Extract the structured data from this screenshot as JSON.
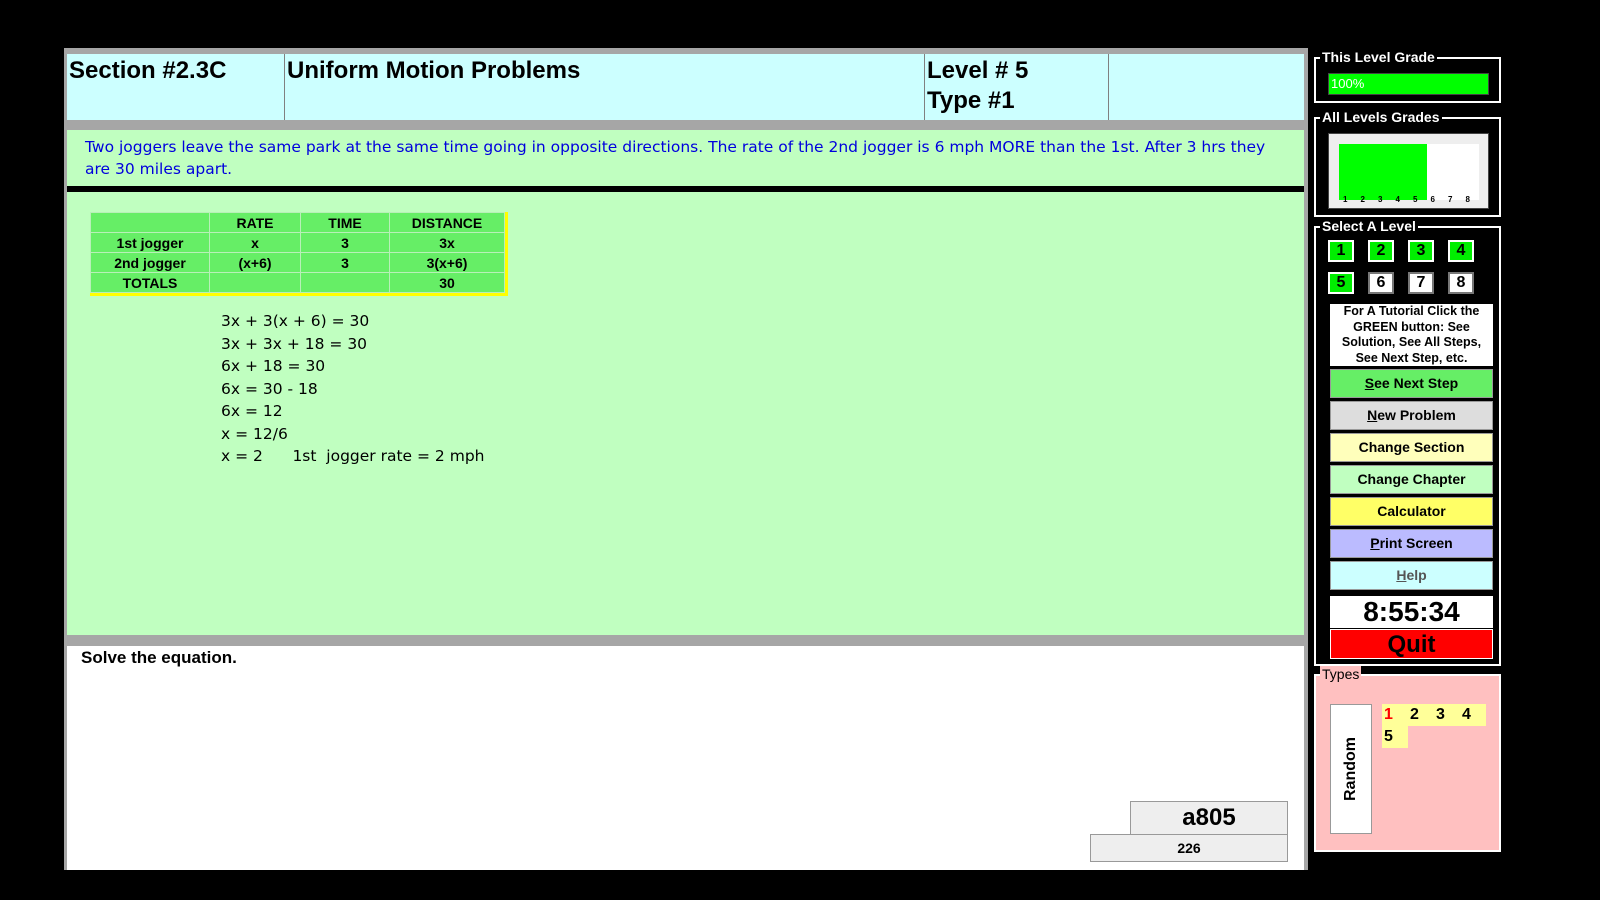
{
  "header": {
    "section": "Section #2.3C",
    "title": "Uniform Motion Problems",
    "level": "Level # 5",
    "type": "Type #1"
  },
  "problem": {
    "text": "Two joggers leave the same park at the same time going in opposite directions. The rate of the 2nd  jogger is 6 mph MORE than the 1st.  After 3 hrs they are  30 miles apart."
  },
  "table": {
    "headers": [
      "",
      "RATE",
      "TIME",
      "DISTANCE"
    ],
    "rows": [
      [
        "1st  jogger",
        "x",
        "3",
        "3x"
      ],
      [
        "2nd  jogger",
        "(x+6)",
        "3",
        "3(x+6)"
      ],
      [
        "TOTALS",
        "",
        "",
        "30"
      ]
    ]
  },
  "steps": [
    "3x + 3(x + 6) = 30",
    "3x + 3x + 18 = 30",
    "6x + 18 = 30",
    "6x = 30 - 18",
    "6x = 12",
    "x = 12/6",
    "x = 2      1st  jogger rate = 2 mph"
  ],
  "instruction": "Solve the equation.",
  "code": "a805",
  "number": "226",
  "panel": {
    "this_level_grade_label": "This Level Grade",
    "this_level_grade": "100%",
    "this_level_grade_fraction": 1.0,
    "all_levels_label": "All Levels Grades",
    "all_levels_numbers": [
      "1",
      "2",
      "3",
      "4",
      "5",
      "6",
      "7",
      "8"
    ],
    "all_levels_completed": 5,
    "select_level_label": "Select A Level",
    "levels": [
      {
        "n": "1",
        "done": true
      },
      {
        "n": "2",
        "done": true
      },
      {
        "n": "3",
        "done": true
      },
      {
        "n": "4",
        "done": true
      },
      {
        "n": "5",
        "done": true
      },
      {
        "n": "6",
        "done": false
      },
      {
        "n": "7",
        "done": false
      },
      {
        "n": "8",
        "done": false
      }
    ],
    "tutorial": "For A Tutorial Click the GREEN button: See Solution, See All Steps, See Next Step, etc.",
    "buttons": {
      "see_next_step": "See Next Step",
      "new_problem": "New Problem",
      "change_section": "Change Section",
      "change_chapter": "Change Chapter",
      "calculator": "Calculator",
      "print_screen": "Print Screen",
      "help": "Help"
    },
    "clock": "8:55:34",
    "quit": "Quit",
    "types_label": "Types",
    "random_label": "Random",
    "types": [
      "1",
      "2",
      "3",
      "4",
      "5"
    ],
    "colors": {
      "green": "#00ff00",
      "red": "#ff0000",
      "yellow": "#ffff66",
      "purple": "#bbbbff",
      "cyan": "#ccffff",
      "light_green": "#c0ffc0",
      "pink": "#ffc0c0"
    }
  }
}
